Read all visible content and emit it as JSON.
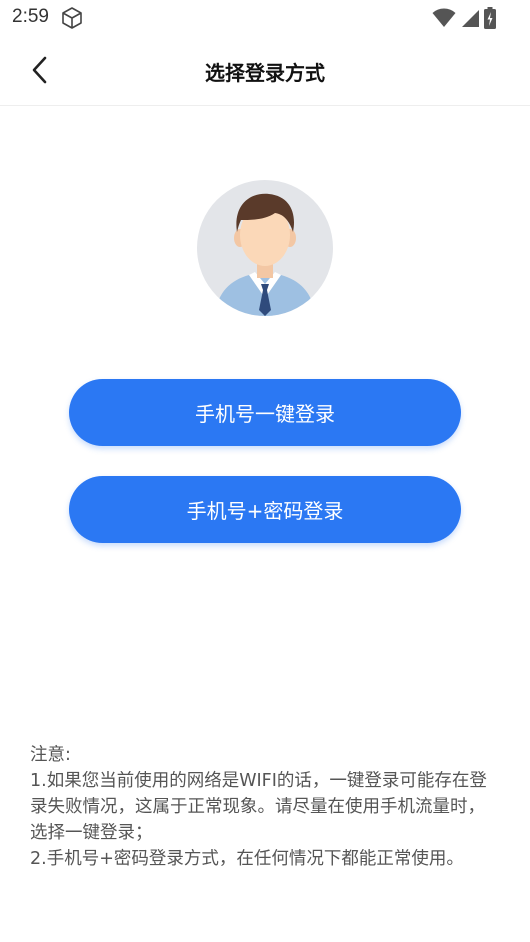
{
  "status_bar": {
    "time": "2:59"
  },
  "header": {
    "title": "选择登录方式"
  },
  "buttons": {
    "one_click": "手机号一键登录",
    "phone_password": "手机号+密码登录"
  },
  "notice": {
    "title": "注意:",
    "item1": " 1.如果您当前使用的网络是WIFI的话，一键登录可能存在登录失败情况，这属于正常现象。请尽量在使用手机流量时，选择一键登录；",
    "item2": " 2.手机号+密码登录方式，在任何情况下都能正常使用。"
  },
  "colors": {
    "accent": "#2b78f3",
    "avatar_bg": "#e3e5e9",
    "hair": "#5a3a2a",
    "skin": "#fbd8b8",
    "shirt": "#9ec0e2",
    "tie": "#2f4b7c"
  },
  "icons": [
    "cube-icon",
    "wifi-icon",
    "signal-icon",
    "battery-icon",
    "back-arrow-icon"
  ]
}
